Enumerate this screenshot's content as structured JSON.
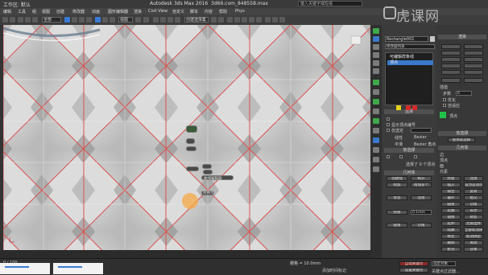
{
  "titlebar": {
    "workspace_label": "工作区: 默认",
    "app_title": "Autodesk 3ds Max 2016",
    "file_name": "3d66.com_848558.max",
    "search_placeholder": "键入关键字或短语"
  },
  "menubar": {
    "items": [
      "编辑",
      "工具",
      "组",
      "视图",
      "创建",
      "修改器",
      "动画",
      "图形编辑器",
      "渲染",
      "Civil View",
      "自定义",
      "脚本",
      "内容",
      "帮助",
      "Phys"
    ]
  },
  "toolbar": {
    "all_filter": "全部",
    "view_dropdown": "视图",
    "selection_set": "创建选择集"
  },
  "watermark": {
    "text": "虎课网"
  },
  "viewport": {
    "background_color": "#cdcdcd",
    "line_color": "#d9534f"
  },
  "quad_menu": {
    "items": [
      "移动",
      "旋转",
      "缩放",
      "选择",
      "克隆",
      "属性",
      "曲线编辑器",
      "转换为"
    ]
  },
  "modify_panel": {
    "object_name": "Rectangle001",
    "modifier_list_label": "修改器列表",
    "modifiers": [
      "可编辑样条线",
      "顶点",
      "线段",
      "样条线"
    ],
    "selection_rollout": "选择",
    "show_vertex_numbers": "显示顶点编号",
    "selected_only": "仅选定",
    "soft_selection_rollout": "软选择",
    "geometry_rollout": "几何体",
    "new_vertex_type": "新顶点类型",
    "linear": "线性",
    "bezier": "Bezier",
    "smooth": "平滑",
    "bezier_corner": "Bezier 角点",
    "create_line": "创建线",
    "break": "断开",
    "attach": "附加",
    "attach_mult": "附加多个",
    "refine": "优化",
    "connect": "连接",
    "weld": "焊接",
    "weld_value": "0.1mm",
    "fillet": "圆角",
    "chamfer": "切角",
    "status": "选择了 0 个顶点"
  },
  "right_panel": {
    "header": "渲染",
    "interpolation": "插值",
    "steps_label": "步数",
    "steps_value": "6",
    "optimize": "优化",
    "adaptive": "自适应",
    "vertex_label": "顶点",
    "bezier_corner_label": "Bezier 角点",
    "soft_selection": "软选择",
    "use_soft": "使用软选择",
    "geometry": "几何体",
    "selection_items": [
      "边",
      "顶点",
      "面",
      "元素"
    ],
    "buttons": [
      "焊接",
      "连接",
      "插入",
      "设为首顶点",
      "熔合",
      "反转",
      "循环",
      "相交",
      "圆角",
      "切角",
      "轮廓",
      "布尔",
      "镜像",
      "修剪",
      "延伸",
      "无限边界",
      "隐藏",
      "全部取消隐藏",
      "绑定",
      "取消绑定",
      "删除",
      "关闭",
      "拆分",
      "分离",
      "炸开",
      "显示",
      "选择"
    ]
  },
  "status_bar": {
    "time_display": "0 / 100",
    "grid": "栅格 = 10.0mm",
    "add_time_tag": "添加时间标记",
    "autokey": "自动关键点",
    "set_key": "设置关键点",
    "selected": "选定对象",
    "key_filters": "关键点过滤器..."
  },
  "colors": {
    "accent_blue": "#3a78c8",
    "yellow_swatch": "#e6d21a",
    "green_swatch": "#21c24a",
    "red_swatch": "#d42a2a"
  }
}
